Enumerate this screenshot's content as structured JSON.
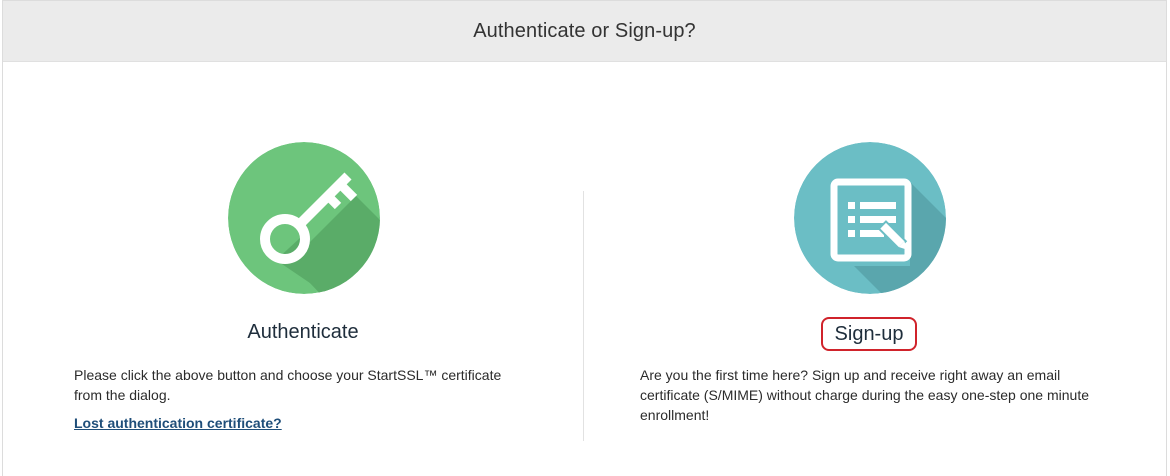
{
  "header": {
    "title": "Authenticate or Sign-up?"
  },
  "authenticate": {
    "icon": "key-icon",
    "heading": "Authenticate",
    "description": "Please click the above button and choose your StartSSL™ certificate from the dialog.",
    "link": "Lost authentication certificate?",
    "color": "#6dc57c",
    "shadow_color": "#5aac68"
  },
  "signup": {
    "icon": "form-edit-icon",
    "heading": "Sign-up",
    "description": "Are you the first time here? Sign up and receive right away an email certificate (S/MIME) without charge during the easy one-step one minute enrollment!",
    "color": "#6bbec5",
    "shadow_color": "#5aa6ad",
    "highlight_color": "#d0232b"
  }
}
